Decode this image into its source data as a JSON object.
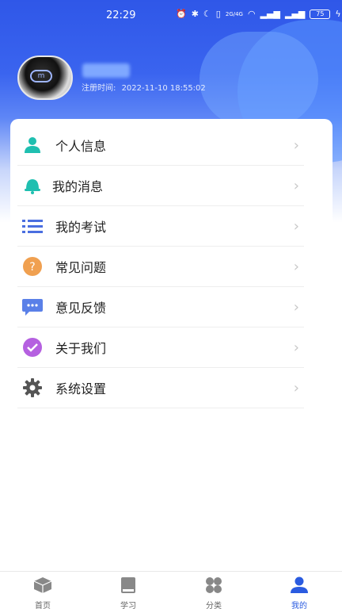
{
  "status_bar": {
    "time": "22:29",
    "network": "2G/4G",
    "battery": "75"
  },
  "profile": {
    "reg_label": "注册时间:",
    "reg_time": "2022-11-10 18:55:02"
  },
  "menu": [
    {
      "label": "个人信息",
      "icon": "person-icon",
      "color": "#1fbfb0"
    },
    {
      "label": "我的消息",
      "icon": "bell-icon",
      "color": "#1fbfb0"
    },
    {
      "label": "我的考试",
      "icon": "list-icon",
      "color": "#4a6ee0"
    },
    {
      "label": "常见问题",
      "icon": "question-icon",
      "color": "#f0a050"
    },
    {
      "label": "意见反馈",
      "icon": "chat-icon",
      "color": "#5a80e8"
    },
    {
      "label": "关于我们",
      "icon": "check-badge-icon",
      "color": "#b560e0"
    },
    {
      "label": "系统设置",
      "icon": "gear-icon",
      "color": "#555555"
    }
  ],
  "tabs": [
    {
      "label": "首页",
      "icon": "box-icon"
    },
    {
      "label": "学习",
      "icon": "book-icon"
    },
    {
      "label": "分类",
      "icon": "grid-icon"
    },
    {
      "label": "我的",
      "icon": "user-icon"
    }
  ],
  "colors": {
    "accent": "#2a5be0",
    "header": "#2f57e8"
  }
}
